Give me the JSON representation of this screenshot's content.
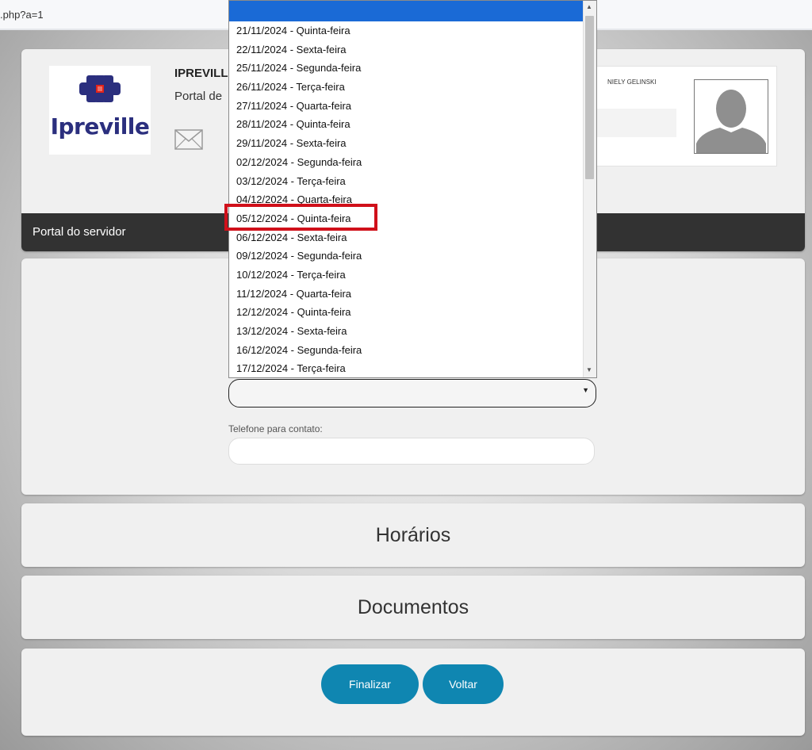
{
  "browser": {
    "url_fragment": ".php?a=1"
  },
  "header": {
    "logo_text": "Ipreville",
    "org_title": "IPREVILL",
    "org_subtitle": "Portal de",
    "user_name": "NIELY GELINSKI"
  },
  "navbar": {
    "title": "Portal do servidor"
  },
  "form": {
    "selected_value": "",
    "phone_label": "Telefone para contato:",
    "phone_value": ""
  },
  "dropdown": {
    "options": [
      "21/11/2024 - Quinta-feira",
      "22/11/2024 - Sexta-feira",
      "25/11/2024 - Segunda-feira",
      "26/11/2024 - Terça-feira",
      "27/11/2024 - Quarta-feira",
      "28/11/2024 - Quinta-feira",
      "29/11/2024 - Sexta-feira",
      "02/12/2024 - Segunda-feira",
      "03/12/2024 - Terça-feira",
      "04/12/2024 - Quarta-feira",
      "05/12/2024 - Quinta-feira",
      "06/12/2024 - Sexta-feira",
      "09/12/2024 - Segunda-feira",
      "10/12/2024 - Terça-feira",
      "11/12/2024 - Quarta-feira",
      "12/12/2024 - Quinta-feira",
      "13/12/2024 - Sexta-feira",
      "16/12/2024 - Segunda-feira",
      "17/12/2024 - Terça-feira"
    ],
    "highlighted_option": "05/12/2024 - Quinta-feira"
  },
  "sections": {
    "horarios": "Horários",
    "documentos": "Documentos"
  },
  "buttons": {
    "finalizar": "Finalizar",
    "voltar": "Voltar"
  },
  "colors": {
    "button_bg": "#0f86b1",
    "navbar_bg": "#323232",
    "highlight": "#d0101a",
    "logo_primary": "#2b2f7e",
    "logo_accent": "#e2231a"
  }
}
